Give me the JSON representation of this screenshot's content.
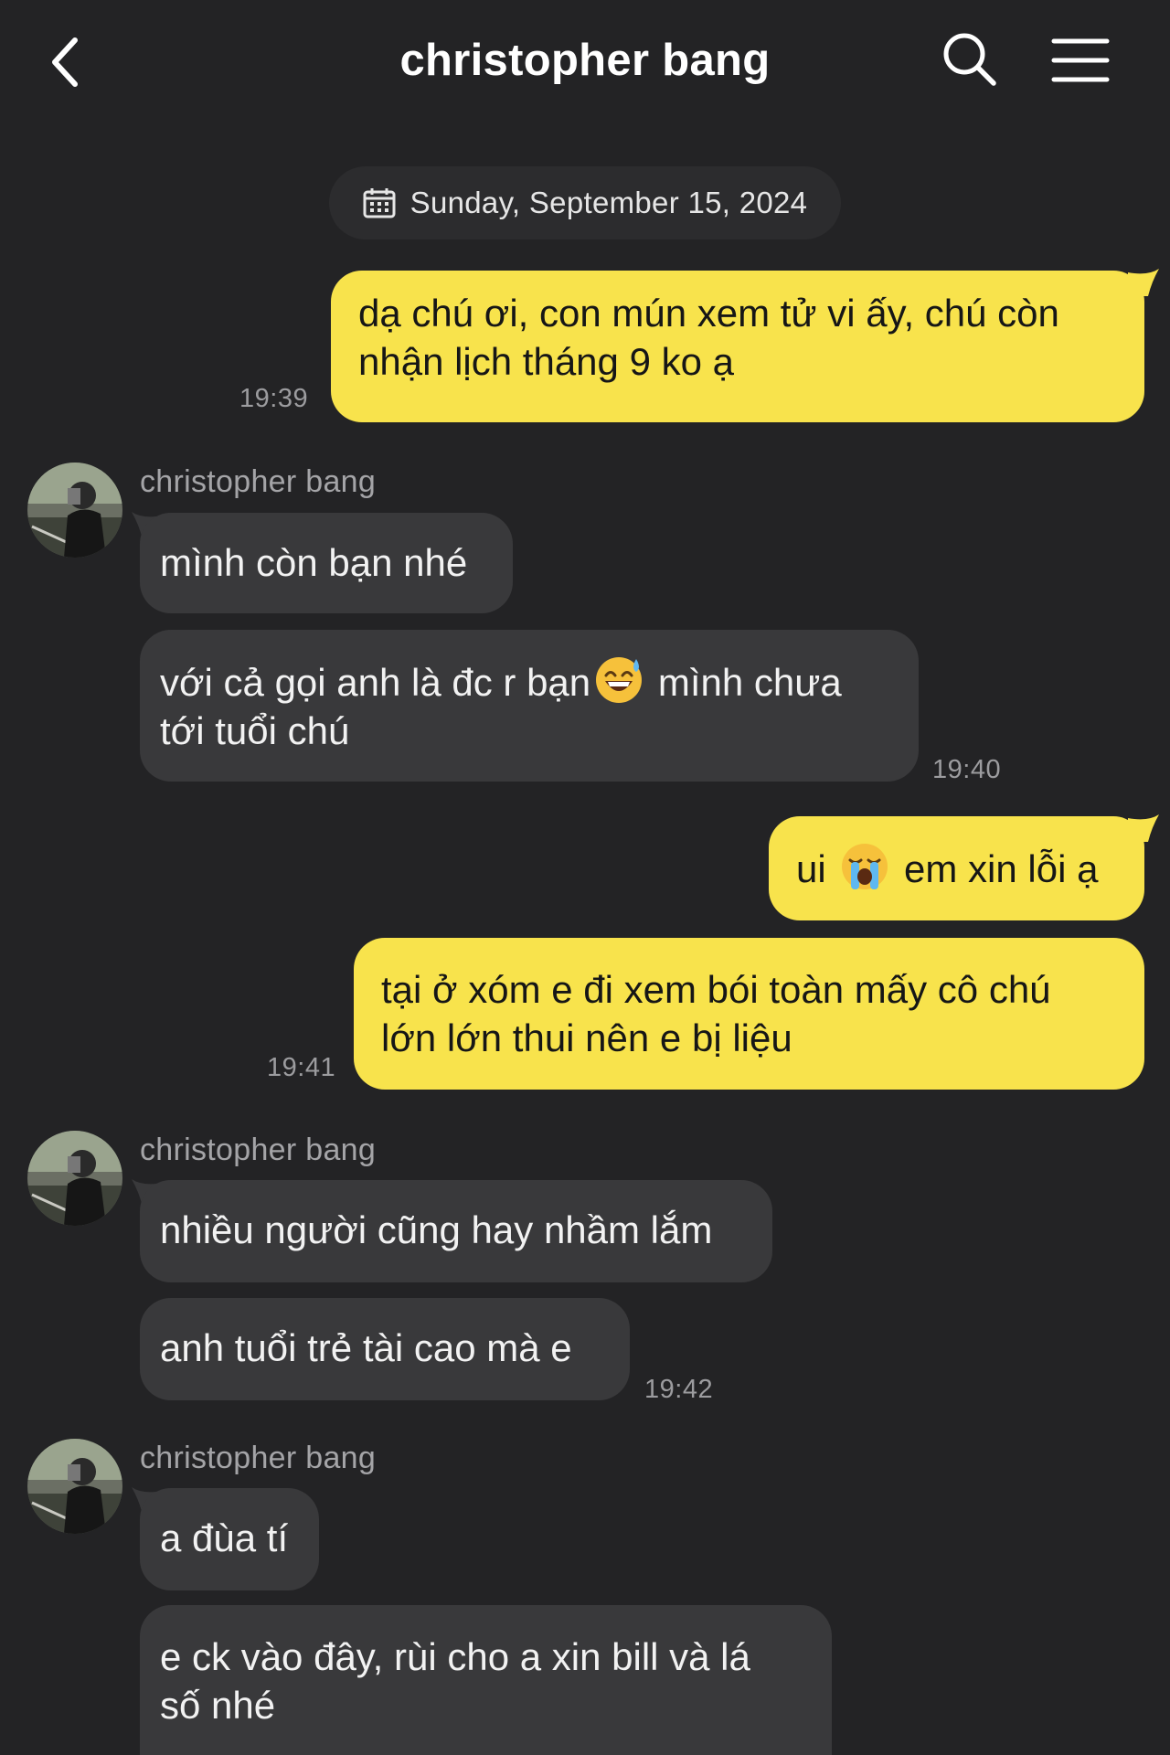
{
  "header": {
    "title": "christopher bang"
  },
  "date_label": "Sunday, September 15, 2024",
  "contact_name": "christopher bang",
  "messages": [
    {
      "text_1": "dạ chú ơi, con mún xem tử vi ấy, chú còn",
      "text_2": "nhận lịch tháng 9 ko ạ",
      "time": "19:39"
    },
    {
      "text": "mình còn bạn nhé"
    },
    {
      "text_a": "với cả gọi anh là đc r bạn",
      "text_b": "mình chưa",
      "text_2": "tới tuổi chú",
      "emoji": "sweat-smile-emoji",
      "time": "19:40"
    },
    {
      "text_a": "ui",
      "text_b": "em xin lỗi ạ",
      "emoji": "loudly-crying-emoji"
    },
    {
      "text_1": "tại ở xóm e đi xem bói toàn mấy cô chú",
      "text_2": "lớn lớn thui nên e bị liệu",
      "time": "19:41"
    },
    {
      "text": "nhiều người cũng hay nhầm lắm"
    },
    {
      "text": "anh tuổi trẻ tài cao mà e",
      "time": "19:42"
    },
    {
      "text": "a đùa tí"
    },
    {
      "text_1": "e ck vào đây, rùi cho a xin bill và lá",
      "text_2": "số nhé"
    }
  ],
  "colors": {
    "background": "#232325",
    "outgoing": "#f8e34c",
    "incoming": "#39393b"
  },
  "icons": [
    "back-icon",
    "search-icon",
    "menu-icon",
    "calendar-icon"
  ]
}
